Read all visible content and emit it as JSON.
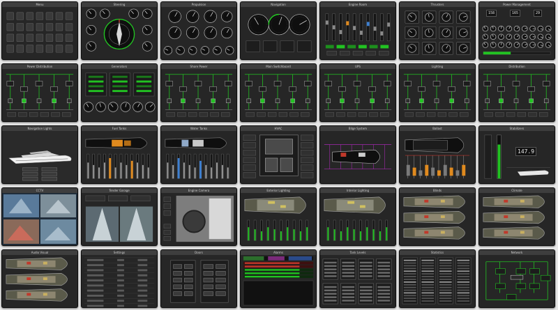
{
  "colors": {
    "background": "#e8e8e8",
    "panel": "#262626",
    "panel_title": "#3e3e3e",
    "accent_green": "#22c322",
    "accent_orange": "#e08a1e",
    "accent_blue": "#3d7fd0",
    "accent_purple": "#a52ab0",
    "accent_red": "#c0392b"
  },
  "panels": [
    {
      "kind": "tiles",
      "title": "Menu"
    },
    {
      "kind": "gauges-compass",
      "title": "Steering"
    },
    {
      "kind": "gauges-grid",
      "title": "Propulsion"
    },
    {
      "kind": "gauges-3",
      "title": "Navigation"
    },
    {
      "kind": "sliders-green",
      "title": "Engine Room"
    },
    {
      "kind": "dials-grid",
      "title": "Thrusters"
    },
    {
      "kind": "readouts",
      "title": "Power Management",
      "readouts": [
        "158",
        "165",
        "29"
      ]
    },
    {
      "kind": "single-line",
      "title": "Power Distribution"
    },
    {
      "kind": "breakers-gauges",
      "title": "Generators"
    },
    {
      "kind": "single-line",
      "title": "Shore Power"
    },
    {
      "kind": "single-line",
      "title": "Main Switchboard"
    },
    {
      "kind": "single-line",
      "title": "UPS"
    },
    {
      "kind": "single-line",
      "title": "Lighting"
    },
    {
      "kind": "single-line",
      "title": "Distribution"
    },
    {
      "kind": "yacht-side",
      "title": "Navigation Lights"
    },
    {
      "kind": "hull-top-orange",
      "title": "Fuel Tanks"
    },
    {
      "kind": "hull-top-blue",
      "title": "Water Tanks"
    },
    {
      "kind": "box-schematic",
      "title": "HVAC"
    },
    {
      "kind": "hull-purple",
      "title": "Bilge System"
    },
    {
      "kind": "tank-bars",
      "title": "Ballast"
    },
    {
      "kind": "level-readout",
      "title": "Stabilizers",
      "readout": "147.9"
    },
    {
      "kind": "camera-quad",
      "title": "CCTV"
    },
    {
      "kind": "camera-split",
      "title": "Tender Garage"
    },
    {
      "kind": "camera-engine",
      "title": "Engine Camera"
    },
    {
      "kind": "deck-plan",
      "title": "Exterior Lighting"
    },
    {
      "kind": "deck-plan",
      "title": "Interior Lighting"
    },
    {
      "kind": "deck-plan-3",
      "title": "Blinds"
    },
    {
      "kind": "deck-plan-3",
      "title": "Climate"
    },
    {
      "kind": "deck-plan-3",
      "title": "Audio Visual"
    },
    {
      "kind": "list-rows",
      "title": "Settings"
    },
    {
      "kind": "control-blocks",
      "title": "Doors"
    },
    {
      "kind": "alarm-table",
      "title": "Alarms"
    },
    {
      "kind": "table-blocks",
      "title": "Tank Levels"
    },
    {
      "kind": "dense-table",
      "title": "Statistics"
    },
    {
      "kind": "network-schematic",
      "title": "Network"
    }
  ]
}
